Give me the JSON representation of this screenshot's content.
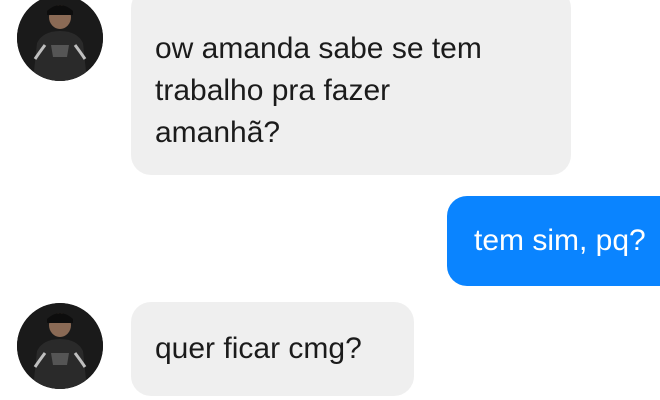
{
  "conversation": {
    "messages": [
      {
        "direction": "incoming",
        "lines": [
          "ow amanda sabe se tem",
          "trabalho pra fazer",
          "amanhã?"
        ],
        "avatar_icon": "contact-avatar"
      },
      {
        "direction": "outgoing",
        "text": "tem sim, pq?"
      },
      {
        "direction": "incoming",
        "text": "quer ficar cmg?",
        "avatar_icon": "contact-avatar"
      }
    ]
  },
  "colors": {
    "background": "#ffffff",
    "incoming_bubble": "#efefef",
    "outgoing_bubble": "#0a84ff",
    "incoming_text": "#1b1b1b",
    "outgoing_text": "#ffffff"
  }
}
